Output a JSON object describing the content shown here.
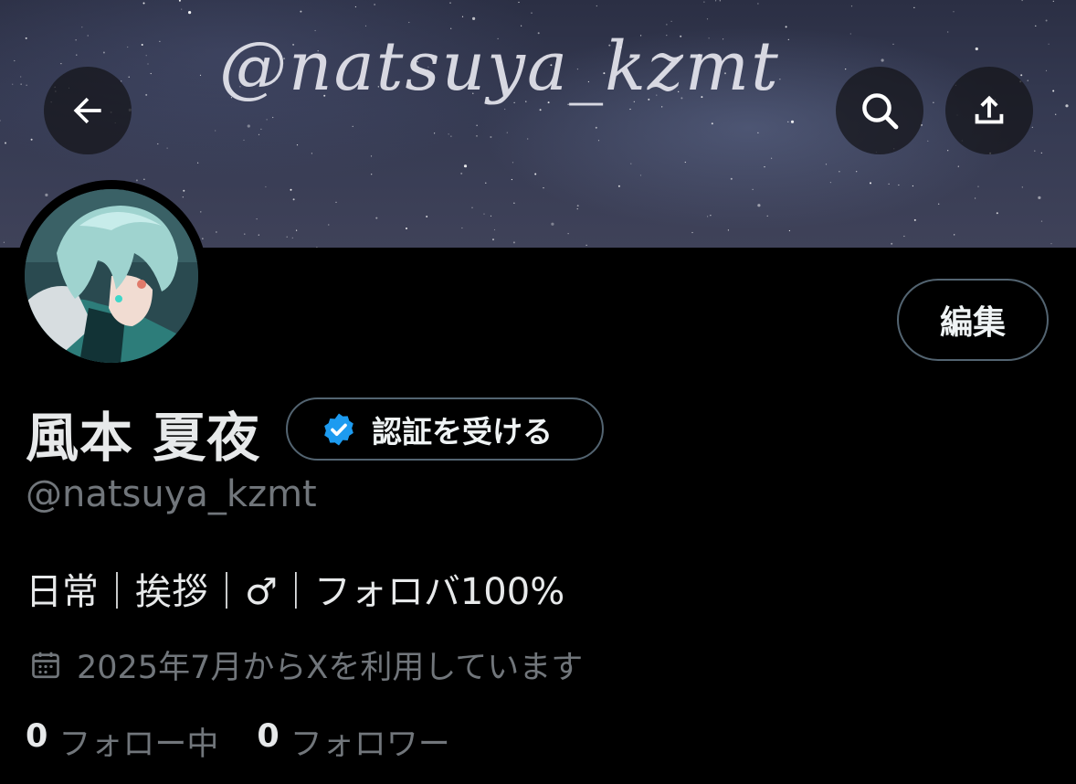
{
  "banner": {
    "text": "@natsuya_kzmt"
  },
  "header": {
    "back_icon": "arrow-left-icon",
    "search_icon": "search-icon",
    "share_icon": "share-icon"
  },
  "profile": {
    "edit_label": "編集",
    "display_name": "風本 夏夜",
    "verify_label": "認証を受ける",
    "handle": "@natsuya_kzmt",
    "bio": "日常｜挨拶｜♂︎｜フォロバ100%",
    "joined": "2025年7月からXを利用しています",
    "following_count": "0",
    "following_label": "フォロー中",
    "followers_count": "0",
    "followers_label": "フォロワー"
  },
  "colors": {
    "background": "#000000",
    "text_primary": "#e7e9ea",
    "text_secondary": "#71767b",
    "border": "#536471",
    "verified_blue": "#1d9bf0"
  }
}
